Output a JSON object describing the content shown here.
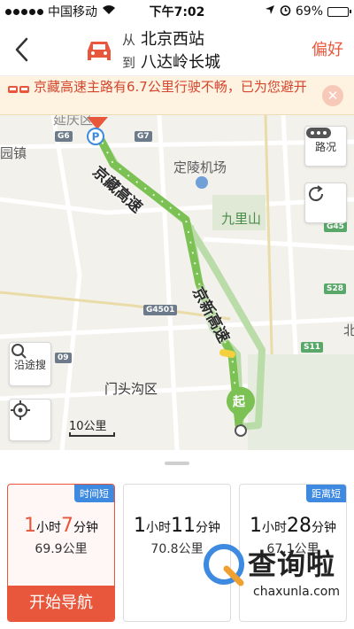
{
  "status_bar": {
    "carrier": "中国移动",
    "time": "下午7:02",
    "battery": "69%",
    "battery_level": 0.69
  },
  "header": {
    "from_prefix": "从",
    "from": "北京西站",
    "to_prefix": "到",
    "to": "八达岭长城",
    "preference_label": "偏好"
  },
  "alert": {
    "text": "京藏高速主路有6.7公里行驶不畅，已为您避开",
    "close": "✕"
  },
  "map": {
    "labels": {
      "yanqing": "延庆区",
      "guzhen": "园镇",
      "dingling": "定陵机场",
      "jiulishan": "九里山",
      "mentougou": "门头沟区",
      "beijing": "北"
    },
    "route_labels": {
      "jingzang": "京藏高速",
      "jingxin": "京新高速"
    },
    "shields": {
      "g6": "G6",
      "g7": "G7",
      "g45": "G45",
      "s28": "S28",
      "g4501": "G4501",
      "s11": "S11",
      "l09": "09"
    },
    "start_marker": "起",
    "traffic_button": "路况",
    "along_search_button": "沿途搜",
    "scale": "10公里",
    "colors": {
      "route_main": "#7bc153",
      "route_alt": "#b9dca8",
      "route_slow": "#f4d03f",
      "accent": "#e8563c"
    }
  },
  "routes": [
    {
      "tag": "时间短",
      "hours": "1",
      "hour_unit": "小时",
      "minutes": "7",
      "minute_unit": "分钟",
      "distance": "69.9公里",
      "action": "开始导航"
    },
    {
      "tag": "",
      "hours": "1",
      "hour_unit": "小时",
      "minutes": "11",
      "minute_unit": "分钟",
      "distance": "70.8公里"
    },
    {
      "tag": "距离短",
      "hours": "1",
      "hour_unit": "小时",
      "minutes": "28",
      "minute_unit": "分钟",
      "distance": "67.1公里"
    }
  ],
  "watermark": {
    "brand": "查询啦",
    "url": "chaxunla.com"
  }
}
